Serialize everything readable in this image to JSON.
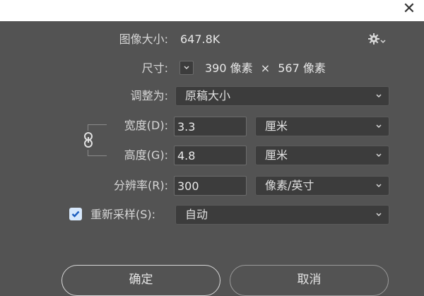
{
  "window": {
    "close_glyph": "✕"
  },
  "image_size": {
    "label": "图像大小:",
    "value": "647.8K"
  },
  "dimensions": {
    "label": "尺寸:",
    "width": "390",
    "width_unit": "像素",
    "times": "×",
    "height": "567",
    "height_unit": "像素"
  },
  "fit_to": {
    "label": "调整为:",
    "selected": "原稿大小"
  },
  "width_row": {
    "label": "宽度(D):",
    "value": "3.3",
    "unit": "厘米"
  },
  "height_row": {
    "label": "高度(G):",
    "value": "4.8",
    "unit": "厘米"
  },
  "resolution_row": {
    "label": "分辨率(R):",
    "value": "300",
    "unit": "像素/英寸"
  },
  "resample": {
    "label": "重新采样(S):",
    "checked": true,
    "selected": "自动"
  },
  "buttons": {
    "ok": "确定",
    "cancel": "取消"
  },
  "icons": [
    "close-icon",
    "gear-icon",
    "chevron-down-icon",
    "link-icon",
    "checkmark-icon"
  ],
  "colors": {
    "background": "#535353",
    "field_bg": "#3c3c3c",
    "checkbox_bg": "#d7e8fb",
    "checkmark": "#1f5fbf"
  }
}
